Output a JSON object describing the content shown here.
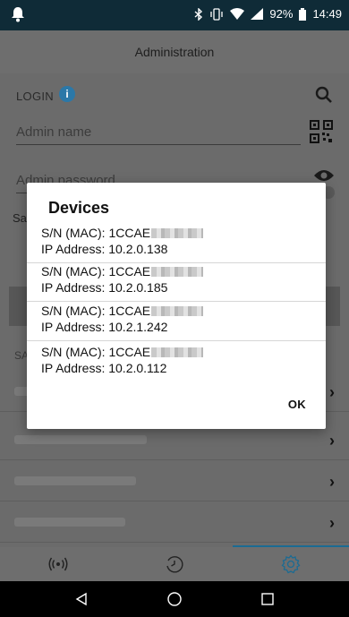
{
  "status_bar": {
    "battery": "92%",
    "time": "14:49"
  },
  "header": {
    "title": "Administration"
  },
  "login": {
    "label": "LOGIN",
    "info_icon": "i",
    "admin_name_placeholder": "Admin name",
    "admin_password_placeholder": "Admin password"
  },
  "background": {
    "partial_label": "Sa",
    "section_label": "SA"
  },
  "dialog": {
    "title": "Devices",
    "devices": [
      {
        "serial": "S/N (MAC): 1CCAE",
        "ip": "IP Address: 10.2.0.138"
      },
      {
        "serial": "S/N (MAC): 1CCAE",
        "ip": "IP Address: 10.2.0.185"
      },
      {
        "serial": "S/N (MAC): 1CCAE",
        "ip": "IP Address: 10.2.1.242"
      },
      {
        "serial": "S/N (MAC): 1CCAE",
        "ip": "IP Address: 10.2.0.112"
      }
    ],
    "ok_label": "OK"
  },
  "bottom_nav": {
    "tabs": [
      {
        "icon": "broadcast-icon",
        "active": false
      },
      {
        "icon": "history-icon",
        "active": false
      },
      {
        "icon": "gear-icon",
        "active": true
      }
    ],
    "accent_color": "#1b6b93"
  },
  "system_nav": {
    "icons": [
      "back-icon",
      "home-icon",
      "recents-icon"
    ]
  }
}
